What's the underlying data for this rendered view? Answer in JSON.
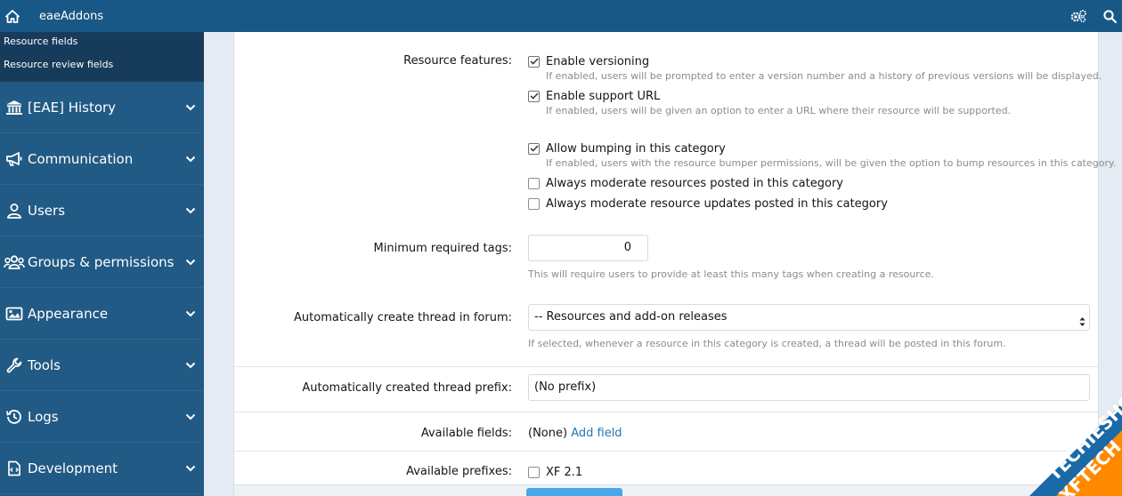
{
  "topbar": {
    "brand": "eaeAddons",
    "home_icon": "home-icon",
    "settings_icon": "cogs-icon",
    "search_icon": "search-icon",
    "background": "#185886"
  },
  "sidebar": {
    "subitems": [
      {
        "label": "Resource fields"
      },
      {
        "label": "Resource review fields"
      }
    ],
    "items": [
      {
        "label": "[EAE] History",
        "icon": "bank-icon"
      },
      {
        "label": "Communication",
        "icon": "megaphone-icon"
      },
      {
        "label": "Users",
        "icon": "user-icon"
      },
      {
        "label": "Groups & permissions",
        "icon": "users-icon"
      },
      {
        "label": "Appearance",
        "icon": "image-icon"
      },
      {
        "label": "Tools",
        "icon": "wrench-icon"
      },
      {
        "label": "Logs",
        "icon": "history-icon"
      },
      {
        "label": "Development",
        "icon": "file-code-icon"
      }
    ]
  },
  "form": {
    "resource_features": {
      "label": "Resource features:",
      "versioning": {
        "label": "Enable versioning",
        "checked": true,
        "hint": "If enabled, users will be prompted to enter a version number and a history of previous versions will be displayed."
      },
      "support_url": {
        "label": "Enable support URL",
        "checked": true,
        "hint": "If enabled, users will be given an option to enter a URL where their resource will be supported."
      }
    },
    "bumping": {
      "label": "Allow bumping in this category",
      "checked": true,
      "hint": "If enabled, users with the resource bumper permissions, will be given the option to bump resources in this category."
    },
    "moderate_resources": {
      "label": "Always moderate resources posted in this category",
      "checked": false
    },
    "moderate_updates": {
      "label": "Always moderate resource updates posted in this category",
      "checked": false
    },
    "min_tags": {
      "label": "Minimum required tags:",
      "value": "0",
      "hint": "This will require users to provide at least this many tags when creating a resource."
    },
    "thread_forum": {
      "label": "Automatically create thread in forum:",
      "value": "-- Resources and add-on releases",
      "hint": "If selected, whenever a resource in this category is created, a thread will be posted in this forum."
    },
    "thread_prefix": {
      "label": "Automatically created thread prefix:",
      "value": "(No prefix)"
    },
    "fields": {
      "label": "Available fields:",
      "none": "(None)",
      "add_link": "Add field"
    },
    "prefixes": {
      "label": "Available prefixes:",
      "option": "XF 2.1",
      "checked": false
    }
  },
  "watermark": {
    "line1": "TECHIESHOME.COM",
    "line2": "XFTECH"
  }
}
